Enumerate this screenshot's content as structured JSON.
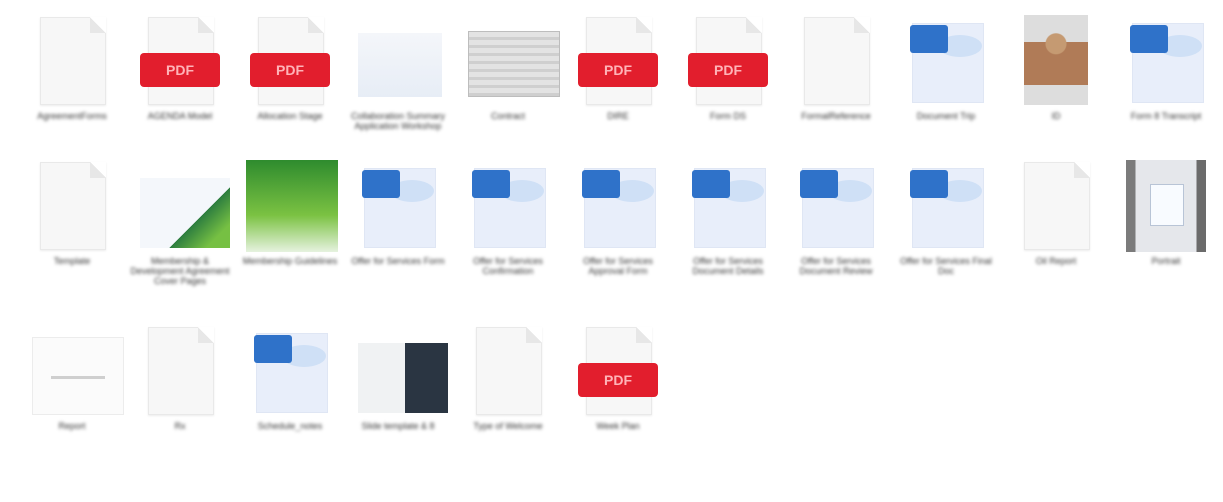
{
  "colors": {
    "pdf_red": "#e21e2d",
    "word_blue": "#2f72c9"
  },
  "pdf_badge_text": "PDF",
  "files": [
    {
      "type": "generic",
      "icon": "document-icon",
      "label": "AgreementForms"
    },
    {
      "type": "pdf",
      "icon": "pdf-icon",
      "label": "AGENDA Model"
    },
    {
      "type": "pdf",
      "icon": "pdf-icon",
      "label": "Allocation Stage"
    },
    {
      "type": "image-doc",
      "icon": "image-thumbnail",
      "label": "Collaboration Summary Application Workshop"
    },
    {
      "type": "image-gray",
      "icon": "image-thumbnail",
      "label": "Contract"
    },
    {
      "type": "pdf",
      "icon": "pdf-icon",
      "label": "DIRE"
    },
    {
      "type": "pdf",
      "icon": "pdf-icon",
      "label": "Form DS"
    },
    {
      "type": "generic",
      "icon": "document-icon",
      "label": "FormalReference"
    },
    {
      "type": "word",
      "icon": "word-doc-icon",
      "label": "Document Trip"
    },
    {
      "type": "image-person",
      "icon": "photo-thumbnail",
      "label": "ID"
    },
    {
      "type": "word",
      "icon": "word-doc-icon",
      "label": "Form 8 Transcript"
    },
    {
      "type": "generic",
      "icon": "document-icon",
      "label": "Template"
    },
    {
      "type": "image-brochure",
      "icon": "image-thumbnail",
      "label": "Membership & Development Agreement Cover Pages"
    },
    {
      "type": "image-green",
      "icon": "image-thumbnail",
      "label": "Membership Guidelines"
    },
    {
      "type": "word",
      "icon": "word-doc-icon",
      "label": "Offer for Services Form"
    },
    {
      "type": "word",
      "icon": "word-doc-icon",
      "label": "Offer for Services Confirmation"
    },
    {
      "type": "word",
      "icon": "word-doc-icon",
      "label": "Offer for Services Approval Form"
    },
    {
      "type": "word",
      "icon": "word-doc-icon",
      "label": "Offer for Services Document Details"
    },
    {
      "type": "word",
      "icon": "word-doc-icon",
      "label": "Offer for Services Document Review"
    },
    {
      "type": "word",
      "icon": "word-doc-icon",
      "label": "Offer for Services Final Doc"
    },
    {
      "type": "generic",
      "icon": "document-icon",
      "label": "Oil Report"
    },
    {
      "type": "image-frame",
      "icon": "image-thumbnail",
      "label": "Portrait"
    },
    {
      "type": "image-report",
      "icon": "image-thumbnail",
      "label": "Report"
    },
    {
      "type": "generic",
      "icon": "document-icon",
      "label": "Rx"
    },
    {
      "type": "word",
      "icon": "word-doc-icon",
      "label": "Schedule_notes"
    },
    {
      "type": "image-dark",
      "icon": "image-thumbnail",
      "label": "Slide template & 8"
    },
    {
      "type": "generic",
      "icon": "document-icon",
      "label": "Type of Welcome"
    },
    {
      "type": "pdf",
      "icon": "pdf-icon",
      "label": "Week Plan"
    }
  ]
}
